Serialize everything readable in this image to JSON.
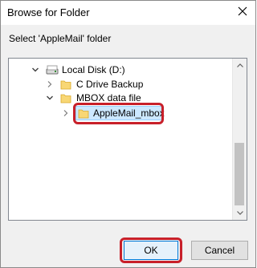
{
  "window": {
    "title": "Browse for Folder",
    "close_icon": "close-icon"
  },
  "instruction": "Select 'AppleMail' folder",
  "tree": {
    "items": [
      {
        "label": "Local Disk (D:)",
        "icon": "drive-icon",
        "expander": "expanded",
        "level": 0
      },
      {
        "label": "C Drive Backup",
        "icon": "folder-icon",
        "expander": "collapsed",
        "level": 1
      },
      {
        "label": "MBOX data file",
        "icon": "folder-icon",
        "expander": "expanded",
        "level": 1
      },
      {
        "label": "AppleMail_mbox",
        "icon": "folder-icon",
        "expander": "collapsed",
        "level": 2,
        "selected": true
      }
    ],
    "scroll_position_fraction": 0.78
  },
  "buttons": {
    "ok_label": "OK",
    "cancel_label": "Cancel"
  },
  "colors": {
    "highlight": "#c8202a",
    "selection": "#cce8ff",
    "folder": "#f8d775",
    "accent": "#0078d7"
  }
}
